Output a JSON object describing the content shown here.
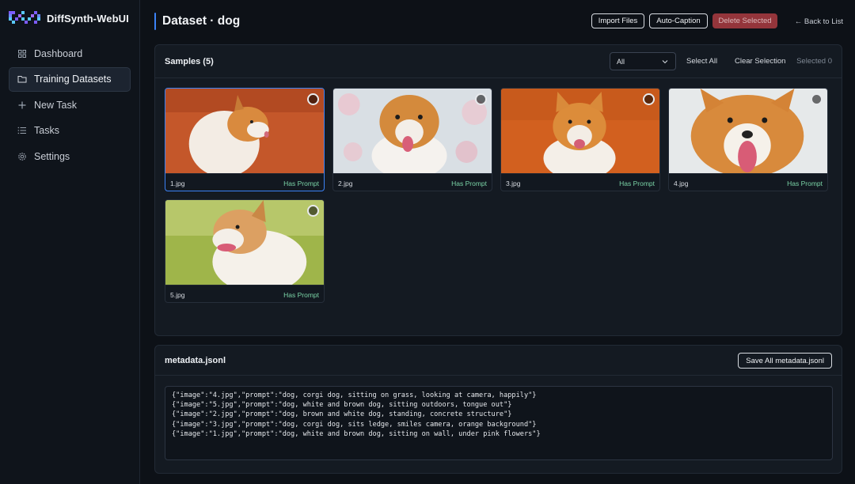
{
  "app": {
    "name": "DiffSynth-WebUI"
  },
  "sidebar": {
    "items": [
      {
        "label": "Dashboard",
        "icon": "grid-icon",
        "active": false
      },
      {
        "label": "Training Datasets",
        "icon": "folder-icon",
        "active": true
      },
      {
        "label": "New Task",
        "icon": "plus-icon",
        "active": false
      },
      {
        "label": "Tasks",
        "icon": "list-icon",
        "active": false
      },
      {
        "label": "Settings",
        "icon": "gear-icon",
        "active": false
      }
    ]
  },
  "header": {
    "title": "Dataset · dog",
    "import_label": "Import Files",
    "caption_label": "Auto-Caption",
    "delete_label": "Delete Selected",
    "back_label": "← Back to List"
  },
  "samples": {
    "title": "Samples (5)",
    "filter_value": "All",
    "select_all_label": "Select All",
    "clear_label": "Clear Selection",
    "selected_count": "Selected 0",
    "items": [
      {
        "name": "1.jpg",
        "status": "Has Prompt",
        "highlighted": true
      },
      {
        "name": "2.jpg",
        "status": "Has Prompt",
        "highlighted": false
      },
      {
        "name": "3.jpg",
        "status": "Has Prompt",
        "highlighted": false
      },
      {
        "name": "4.jpg",
        "status": "Has Prompt",
        "highlighted": false
      },
      {
        "name": "5.jpg",
        "status": "Has Prompt",
        "highlighted": false
      }
    ]
  },
  "metadata": {
    "title": "metadata.jsonl",
    "save_label": "Save All metadata.jsonl",
    "content": "{\"image\":\"4.jpg\",\"prompt\":\"dog, corgi dog, sitting on grass, looking at camera, happily\"}\n{\"image\":\"5.jpg\",\"prompt\":\"dog, white and brown dog, sitting outdoors, tongue out\"}\n{\"image\":\"2.jpg\",\"prompt\":\"dog, brown and white dog, standing, concrete structure\"}\n{\"image\":\"3.jpg\",\"prompt\":\"dog, corgi dog, sits ledge, smiles camera, orange background\"}\n{\"image\":\"1.jpg\",\"prompt\":\"dog, white and brown dog, sitting on wall, under pink flowers\"}"
  },
  "colors": {
    "accent": "#3b82f6",
    "status_ok": "#7ad3a6",
    "danger": "#a33a3f"
  }
}
